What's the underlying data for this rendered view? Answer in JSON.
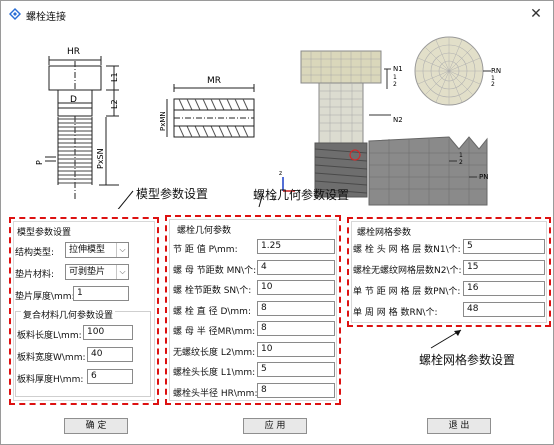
{
  "window": {
    "title": "螺栓连接",
    "close_glyph": "✕"
  },
  "figure": {
    "hr_label": "HR",
    "l1_label": "L1",
    "l2_label": "L2",
    "d_label": "D",
    "p_label": "P",
    "pxsn_label": "PxSN",
    "mr_label": "MR",
    "pxmn_label": "PxMN",
    "n1_label": "N1",
    "n2_label": "N2",
    "rn_label": "RN",
    "pn_label": "PN",
    "axis_1": "1",
    "axis_2": "2",
    "axis_z": "z",
    "axis_x": "x",
    "axis_y": "y"
  },
  "annotations": {
    "model": "模型参数设置",
    "geometry": "螺栓几何参数设置",
    "mesh": "螺栓网格参数设置"
  },
  "model_params": {
    "title": "模型参数设置",
    "structure_label": "结构类型:",
    "structure_value": "拉伸模型",
    "gasket_label": "垫片材料:",
    "gasket_value": "可剥垫片",
    "thickness_label": "垫片厚度\\mm:",
    "thickness_value": "1",
    "composite": {
      "title": "复合材料几何参数设置",
      "length_label": "板料长度L\\mm:",
      "length_value": "100",
      "width_label": "板料宽度W\\mm:",
      "width_value": "40",
      "height_label": "板料厚度H\\mm:",
      "height_value": "6"
    }
  },
  "geometry_params": {
    "title": "螺栓几何参数",
    "rows": [
      {
        "label": "节  距  值  P\\mm:",
        "value": "1.25"
      },
      {
        "label": "螺 母 节距数 MN\\个:",
        "value": "4"
      },
      {
        "label": "螺 栓节距数  SN\\个:",
        "value": "10"
      },
      {
        "label": "螺 栓 直 径  D\\mm:",
        "value": "8"
      },
      {
        "label": "螺 母 半 径MR\\mm:",
        "value": "8"
      },
      {
        "label": "无螺纹长度  L2\\mm:",
        "value": "10"
      },
      {
        "label": "螺栓头长度  L1\\mm:",
        "value": "5"
      },
      {
        "label": "螺栓头半径 HR\\mm:",
        "value": "8"
      }
    ]
  },
  "mesh_params": {
    "title": "螺栓网格参数",
    "rows": [
      {
        "label": "螺 栓 头 网 格 层 数N1\\个:",
        "value": "5"
      },
      {
        "label": "螺栓无螺纹网格层数N2\\个:",
        "value": "15"
      },
      {
        "label": "单 节 距 网 格 层 数PN\\个:",
        "value": "16"
      },
      {
        "label": "单  周  网  格  数RN\\个:",
        "value": "48"
      }
    ]
  },
  "buttons": {
    "ok": "确 定",
    "apply": "应 用",
    "exit": "退 出"
  },
  "colors": {
    "annotation_border": "#dd1111",
    "mesh_fill": "#d9d6b8",
    "mesh_line": "#9c9c9c"
  }
}
